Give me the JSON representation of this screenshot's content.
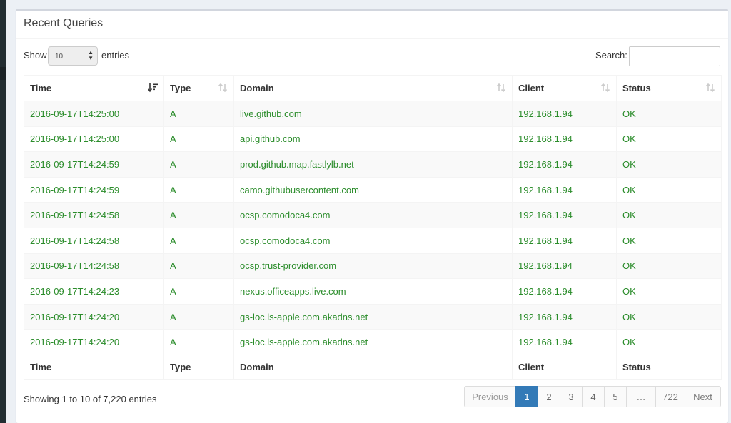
{
  "panel": {
    "title": "Recent Queries"
  },
  "length": {
    "show_label": "Show",
    "value": "10",
    "entries_label": "entries"
  },
  "search": {
    "label": "Search:",
    "value": ""
  },
  "table": {
    "columns": [
      "Time",
      "Type",
      "Domain",
      "Client",
      "Status"
    ],
    "rows": [
      [
        "2016-09-17T14:25:00",
        "A",
        "live.github.com",
        "192.168.1.94",
        "OK"
      ],
      [
        "2016-09-17T14:25:00",
        "A",
        "api.github.com",
        "192.168.1.94",
        "OK"
      ],
      [
        "2016-09-17T14:24:59",
        "A",
        "prod.github.map.fastlylb.net",
        "192.168.1.94",
        "OK"
      ],
      [
        "2016-09-17T14:24:59",
        "A",
        "camo.githubusercontent.com",
        "192.168.1.94",
        "OK"
      ],
      [
        "2016-09-17T14:24:58",
        "A",
        "ocsp.comodoca4.com",
        "192.168.1.94",
        "OK"
      ],
      [
        "2016-09-17T14:24:58",
        "A",
        "ocsp.comodoca4.com",
        "192.168.1.94",
        "OK"
      ],
      [
        "2016-09-17T14:24:58",
        "A",
        "ocsp.trust-provider.com",
        "192.168.1.94",
        "OK"
      ],
      [
        "2016-09-17T14:24:23",
        "A",
        "nexus.officeapps.live.com",
        "192.168.1.94",
        "OK"
      ],
      [
        "2016-09-17T14:24:20",
        "A",
        "gs-loc.ls-apple.com.akadns.net",
        "192.168.1.94",
        "OK"
      ],
      [
        "2016-09-17T14:24:20",
        "A",
        "gs-loc.ls-apple.com.akadns.net",
        "192.168.1.94",
        "OK"
      ]
    ],
    "footer": [
      "Time",
      "Type",
      "Domain",
      "Client",
      "Status"
    ]
  },
  "info": "Showing 1 to 10 of 7,220 entries",
  "pagination": {
    "previous": "Previous",
    "pages": [
      "1",
      "2",
      "3",
      "4",
      "5"
    ],
    "ellipsis": "…",
    "last": "722",
    "next": "Next",
    "active": "1"
  },
  "colors": {
    "row_text": "#2a8c2a",
    "active_page": "#337ab7",
    "sidebar": "#222d32"
  },
  "icons": {
    "sort_active": "sort-amount-desc-icon",
    "sort_inactive": "sort-both-icon",
    "select_caret": "select-caret-icon"
  }
}
